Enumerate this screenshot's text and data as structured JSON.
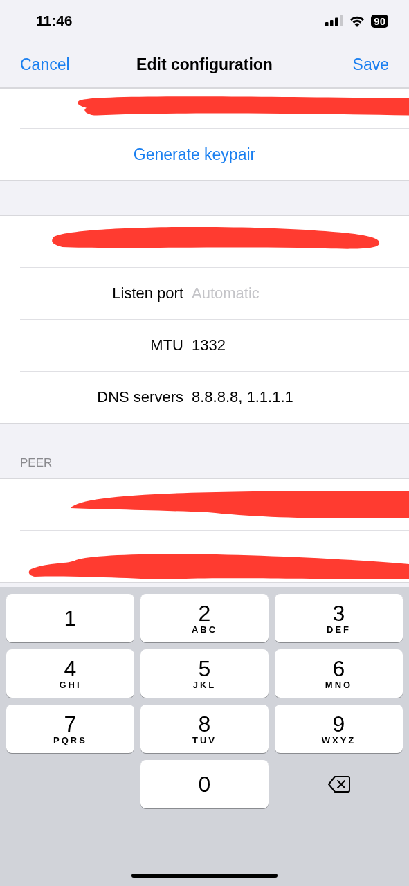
{
  "status_bar": {
    "time": "11:46",
    "battery": "90"
  },
  "nav": {
    "cancel": "Cancel",
    "title": "Edit configuration",
    "save": "Save"
  },
  "sections": [
    {
      "rows": [
        {
          "kind": "redacted"
        },
        {
          "kind": "action",
          "label": "Generate keypair"
        }
      ]
    },
    {
      "rows": [
        {
          "kind": "redacted"
        },
        {
          "kind": "field",
          "label": "Listen port",
          "placeholder": "Automatic"
        },
        {
          "kind": "field",
          "label": "MTU",
          "value": "1332"
        },
        {
          "kind": "field",
          "label": "DNS servers",
          "value": "8.8.8.8, 1.1.1.1"
        }
      ]
    },
    {
      "header": "PEER",
      "rows": [
        {
          "kind": "redacted"
        },
        {
          "kind": "redacted"
        }
      ]
    }
  ],
  "keyboard": [
    {
      "kind": "digit",
      "digit": "1"
    },
    {
      "kind": "digit",
      "digit": "2",
      "letters": "ABC"
    },
    {
      "kind": "digit",
      "digit": "3",
      "letters": "DEF"
    },
    {
      "kind": "digit",
      "digit": "4",
      "letters": "GHI"
    },
    {
      "kind": "digit",
      "digit": "5",
      "letters": "JKL"
    },
    {
      "kind": "digit",
      "digit": "6",
      "letters": "MNO"
    },
    {
      "kind": "digit",
      "digit": "7",
      "letters": "PQRS"
    },
    {
      "kind": "digit",
      "digit": "8",
      "letters": "TUV"
    },
    {
      "kind": "digit",
      "digit": "9",
      "letters": "WXYZ"
    },
    {
      "kind": "empty"
    },
    {
      "kind": "digit",
      "digit": "0"
    },
    {
      "kind": "delete"
    }
  ]
}
